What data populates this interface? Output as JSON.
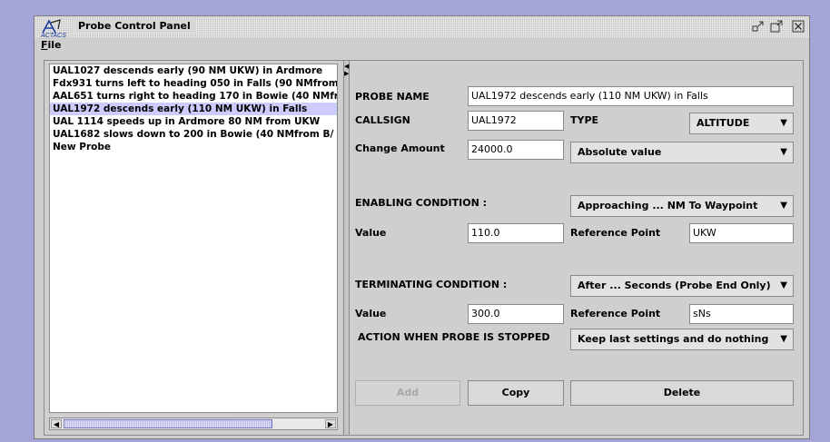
{
  "window": {
    "title": "Probe Control Panel",
    "logo_text": "ACTACS",
    "minimize_icon": "minimize-icon",
    "maximize_icon": "maximize-icon",
    "close_icon": "close-icon"
  },
  "menu": {
    "file_label": "File"
  },
  "probe_list": {
    "items": [
      {
        "label": "UAL1027 descends early (90 NM UKW) in Ardmore",
        "selected": false
      },
      {
        "label": "Fdx931 turns left to heading 050 in Falls (90 NMfrom",
        "selected": false
      },
      {
        "label": "AAL651 turns right to heading 170 in Bowie (40 NMfr",
        "selected": false
      },
      {
        "label": "UAL1972 descends early (110 NM UKW) in Falls",
        "selected": true
      },
      {
        "label": "UAL 1114 speeds up in Ardmore 80 NM from UKW",
        "selected": false
      },
      {
        "label": "UAL1682 slows down to 200 in Bowie (40 NMfrom B/",
        "selected": false
      },
      {
        "label": "New Probe",
        "selected": false
      }
    ],
    "selection_color": "#ccccff"
  },
  "form": {
    "probe_name_label": "PROBE NAME",
    "probe_name_value": "UAL1972 descends early (110 NM UKW) in Falls",
    "callsign_label": "CALLSIGN",
    "callsign_value": "UAL1972",
    "type_label": "TYPE",
    "type_value": "ALTITUDE",
    "change_amount_label": "Change Amount",
    "change_amount_value": "24000.0",
    "change_mode_value": "Absolute value",
    "enabling_label": "ENABLING CONDITION :",
    "enabling_value": "Approaching ... NM To Waypoint",
    "enabling_value_label": "Value",
    "enabling_value_value": "110.0",
    "enabling_ref_label": "Reference Point",
    "enabling_ref_value": "UKW",
    "terminating_label": "TERMINATING CONDITION :",
    "terminating_value": "After ... Seconds (Probe End Only)",
    "terminating_value_label": "Value",
    "terminating_value_value": "300.0",
    "terminating_ref_label": "Reference Point",
    "terminating_ref_value": "sNs",
    "action_label": "ACTION WHEN PROBE IS STOPPED",
    "action_value": "Keep last settings and do nothing"
  },
  "buttons": {
    "add": "Add",
    "copy": "Copy",
    "delete": "Delete"
  },
  "colors": {
    "desktop": "#a4a4d8",
    "window_bg": "#cfcfcf",
    "selection": "#ccccff"
  }
}
